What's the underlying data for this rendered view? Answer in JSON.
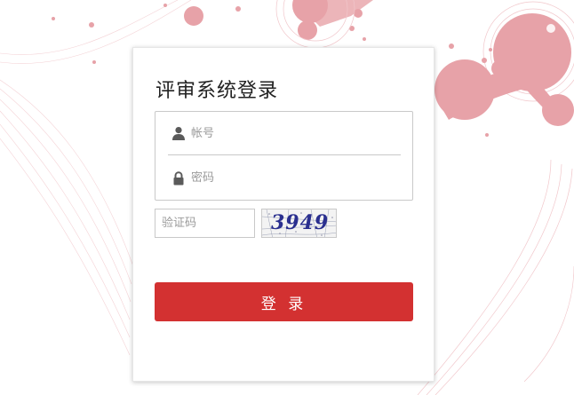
{
  "login": {
    "title": "评审系统登录",
    "username_placeholder": "帐号",
    "password_placeholder": "密码",
    "captcha_placeholder": "验证码",
    "captcha_code": "3949",
    "submit_label": "登 录"
  },
  "colors": {
    "accent": "#d33131",
    "background_art": "#e8a0a6"
  },
  "icons": {
    "username": "user-icon",
    "password": "lock-icon"
  }
}
